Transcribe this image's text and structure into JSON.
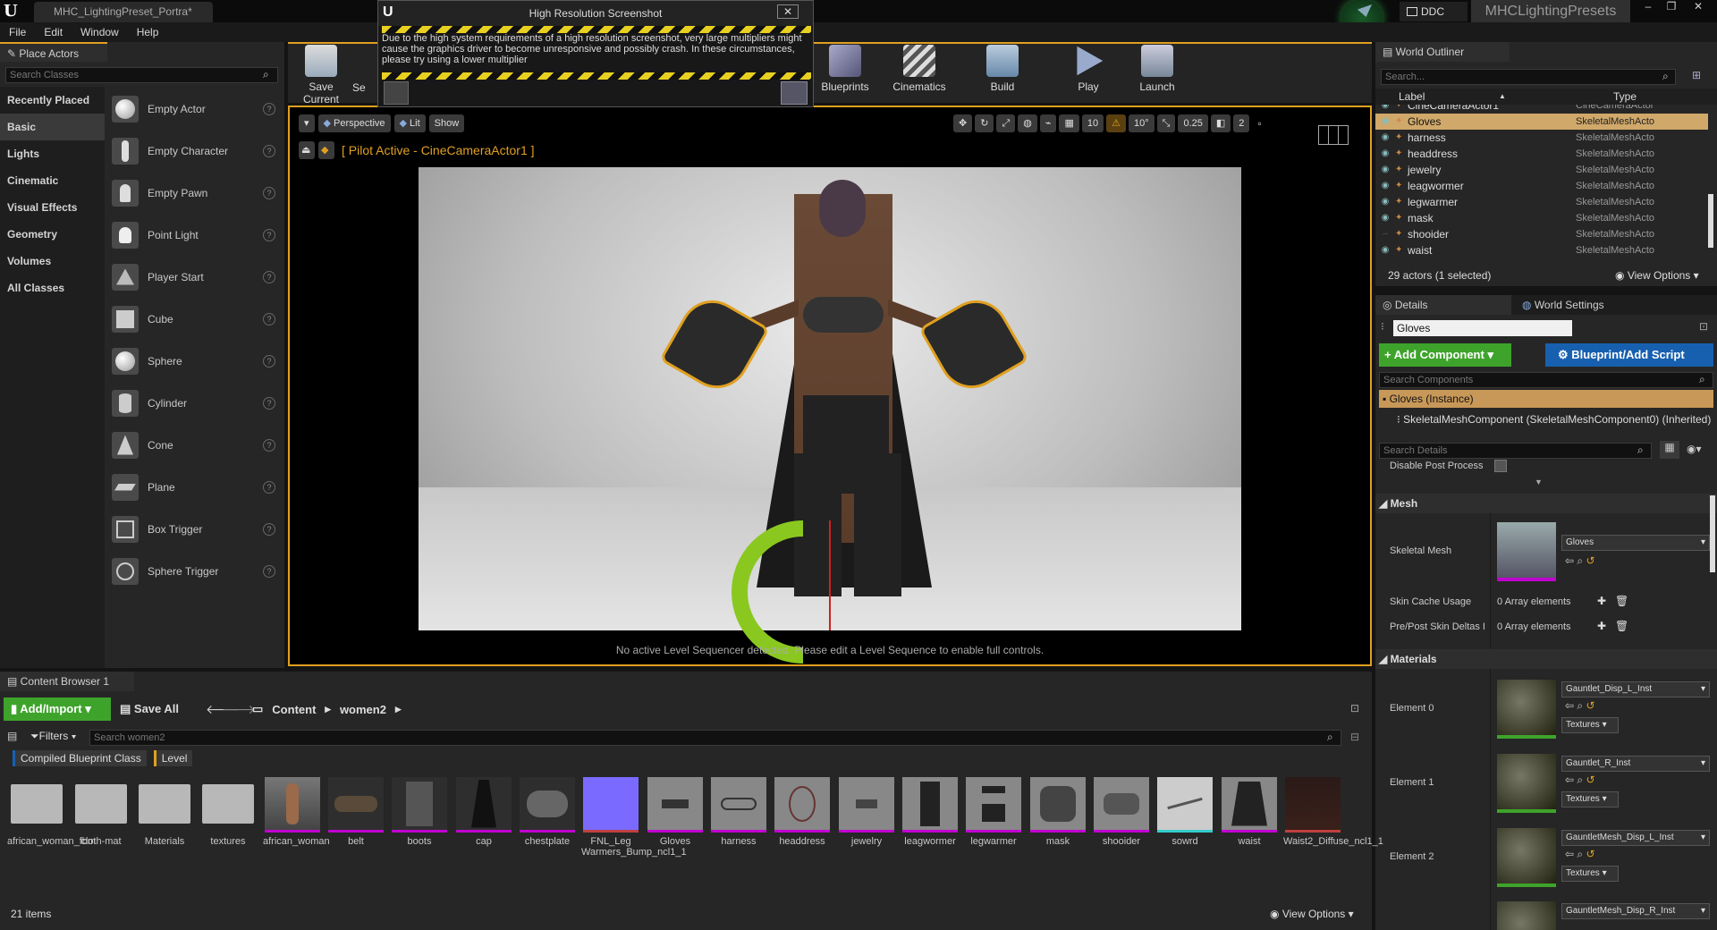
{
  "titlebar": {
    "logo": "U",
    "tab_title": "MHC_LightingPreset_Portra*",
    "ddc_label": "DDC",
    "project_name": "MHCLightingPresets"
  },
  "menu": [
    "File",
    "Edit",
    "Window",
    "Help"
  ],
  "place_actors": {
    "tab": "Place Actors",
    "search_placeholder": "Search Classes",
    "categories": [
      "Recently Placed",
      "Basic",
      "Lights",
      "Cinematic",
      "Visual Effects",
      "Geometry",
      "Volumes",
      "All Classes"
    ],
    "actors": [
      "Empty Actor",
      "Empty Character",
      "Empty Pawn",
      "Point Light",
      "Player Start",
      "Cube",
      "Sphere",
      "Cylinder",
      "Cone",
      "Plane",
      "Box Trigger",
      "Sphere Trigger"
    ]
  },
  "toolbar": {
    "save_current": "Save Current",
    "se_partial": "Se",
    "blueprints": "Blueprints",
    "cinematics": "Cinematics",
    "build": "Build",
    "play": "Play",
    "launch": "Launch"
  },
  "popup": {
    "title": "High Resolution Screenshot",
    "message": "Due to the high system requirements of a high resolution screenshot, very large multipliers might cause the graphics driver to become unresponsive and possibly crash. In these circumstances, please try using a lower multiplier",
    "close": "✕"
  },
  "viewport": {
    "perspective": "Perspective",
    "lit": "Lit",
    "show": "Show",
    "grid_value": "10",
    "angle_value": "10°",
    "scale_value": "0.25",
    "camera_speed": "2",
    "pilot_text": "[ Pilot Active - CineCameraActor1 ]",
    "sequencer_msg": "No active Level Sequencer detected. Please edit a Level Sequence to enable full controls."
  },
  "outliner": {
    "tab": "World Outliner",
    "search_placeholder": "Search...",
    "col_label": "Label",
    "col_type": "Type",
    "rows": [
      {
        "label": "CineCameraActor1",
        "type": "CineCameraActor"
      },
      {
        "label": "Gloves",
        "type": "SkeletalMeshActo"
      },
      {
        "label": "harness",
        "type": "SkeletalMeshActo"
      },
      {
        "label": "headdress",
        "type": "SkeletalMeshActo"
      },
      {
        "label": "jewelry",
        "type": "SkeletalMeshActo"
      },
      {
        "label": "leagwormer",
        "type": "SkeletalMeshActo"
      },
      {
        "label": "legwarmer",
        "type": "SkeletalMeshActo"
      },
      {
        "label": "mask",
        "type": "SkeletalMeshActo"
      },
      {
        "label": "shooider",
        "type": "SkeletalMeshActo"
      },
      {
        "label": "waist",
        "type": "SkeletalMeshActo"
      }
    ],
    "count": "29 actors (1 selected)",
    "view_options": "View Options"
  },
  "details": {
    "tab": "Details",
    "tab2": "World Settings",
    "name_value": "Gloves",
    "add_component": "Add Component",
    "blueprint_script": "Blueprint/Add Script",
    "search_components": "Search Components",
    "instance": "Gloves (Instance)",
    "component": "SkeletalMeshComponent (SkeletalMeshComponent0) (Inherited)",
    "search_details": "Search Details",
    "disable_post": "Disable Post Process",
    "mesh_section": "Mesh",
    "skeletal_mesh_label": "Skeletal Mesh",
    "skeletal_mesh_value": "Gloves",
    "skin_cache_label": "Skin Cache Usage",
    "skin_cache_value": "0 Array elements",
    "prepost_label": "Pre/Post Skin Deltas I",
    "prepost_value": "0 Array elements",
    "materials_section": "Materials",
    "materials": [
      {
        "label": "Element 0",
        "value": "Gauntlet_Disp_L_Inst"
      },
      {
        "label": "Element 1",
        "value": "Gauntlet_R_Inst"
      },
      {
        "label": "Element 2",
        "value": "GauntletMesh_Disp_L_Inst"
      },
      {
        "label": "",
        "value": "GauntletMesh_Disp_R_Inst"
      }
    ],
    "textures": "Textures"
  },
  "content_browser": {
    "tab": "Content Browser 1",
    "add_import": "Add/Import",
    "save_all": "Save All",
    "path": [
      "Content",
      "women2"
    ],
    "filters": "Filters",
    "search_placeholder": "Search women2",
    "filter_chips": [
      "Compiled Blueprint Class",
      "Level"
    ],
    "items": [
      {
        "name": "african_woman_fbm",
        "kind": "folder"
      },
      {
        "name": "cloth-mat",
        "kind": "folder"
      },
      {
        "name": "Materials",
        "kind": "folder"
      },
      {
        "name": "textures",
        "kind": "folder"
      },
      {
        "name": "african_woman",
        "kind": "asset"
      },
      {
        "name": "belt",
        "kind": "asset"
      },
      {
        "name": "boots",
        "kind": "asset"
      },
      {
        "name": "cap",
        "kind": "asset"
      },
      {
        "name": "chestplate",
        "kind": "asset"
      },
      {
        "name": "FNL_Leg Warmers_Bump_ncl1_1",
        "kind": "texture"
      },
      {
        "name": "Gloves",
        "kind": "asset"
      },
      {
        "name": "harness",
        "kind": "asset"
      },
      {
        "name": "headdress",
        "kind": "asset"
      },
      {
        "name": "jewelry",
        "kind": "asset"
      },
      {
        "name": "leagwormer",
        "kind": "asset"
      },
      {
        "name": "legwarmer",
        "kind": "asset"
      },
      {
        "name": "mask",
        "kind": "asset"
      },
      {
        "name": "shooider",
        "kind": "asset"
      },
      {
        "name": "sowrd",
        "kind": "asset"
      },
      {
        "name": "waist",
        "kind": "asset"
      },
      {
        "name": "Waist2_Diffuse_ncl1_1",
        "kind": "texture"
      }
    ],
    "count": "21 items",
    "view_options": "View Options"
  },
  "colors": {
    "accent": "#e0a020",
    "green": "#3ea32b",
    "blue": "#1760b0",
    "magenta": "#c000d0"
  }
}
